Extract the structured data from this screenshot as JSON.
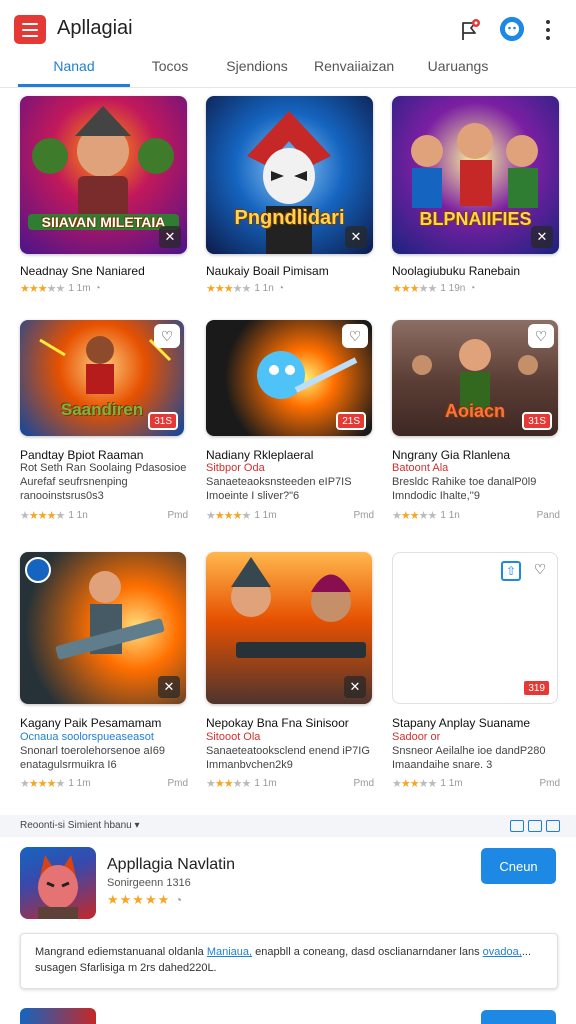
{
  "app": {
    "title": "Apllagiai"
  },
  "header": {
    "menu_icon": "hamburger-menu-icon",
    "flag_icon": "flag-notification-icon",
    "avatar_icon": "avatar-icon",
    "more_icon": "more-vert-icon",
    "accent_color": "#1e7fd6",
    "brand_color": "#e53935"
  },
  "tabs": [
    {
      "label": "Nanad",
      "active": true
    },
    {
      "label": "Tocos"
    },
    {
      "label": "Sjendions"
    },
    {
      "label": "Renvaiiaizan"
    },
    {
      "label": "Uaruangs"
    }
  ],
  "cards": [
    {
      "art_title": "SIIAVAN MILETAIA",
      "name": "Neadnay Sne Naniared",
      "lines": [],
      "rating": 3.5,
      "meta": "1 1m",
      "right": "",
      "corner": "x"
    },
    {
      "art_title": "Pngndlidari",
      "name": "Naukaiy Boail Pimisam",
      "lines": [],
      "rating": 3.5,
      "meta": "1 1n",
      "right": "",
      "corner": "x"
    },
    {
      "art_title": "BLPNAIIFIES",
      "name": "Noolagiubuku Ranebain",
      "lines": [],
      "rating": 3.5,
      "meta": "1 19n",
      "right": "",
      "corner": "x"
    },
    {
      "art_title": "Saandiren",
      "name": "Pandtay Bpiot Raaman",
      "lines": [
        {
          "text": "Rot Seth Ran Soolaing Pdasosioe",
          "style": ""
        },
        {
          "text": "Aurefaf seufrsnenping",
          "style": ""
        },
        {
          "text": "ranooinstsrus0s3",
          "style": ""
        }
      ],
      "rating": 3.5,
      "meta": "1 1n",
      "right": "Pmd",
      "badge": "31S"
    },
    {
      "art_title": "",
      "name": "Nadiany Rkleplaeral",
      "lines": [
        {
          "text": "Sitbpor Oda",
          "style": "red"
        },
        {
          "text": "Sanaeteaoksnsteeden eIP7IS",
          "style": ""
        },
        {
          "text": "Imoeinte I sliver?\"6",
          "style": ""
        }
      ],
      "rating": 3.5,
      "meta": "1 1m",
      "right": "Pmd",
      "badge": "21S"
    },
    {
      "art_title": "Aoiacn",
      "name": "Nngrany Gia Rlanlena",
      "lines": [
        {
          "text": "Batoont Ala",
          "style": "red"
        },
        {
          "text": "Bresldc Rahike toe danalP0l9",
          "style": ""
        },
        {
          "text": "Imndodic Ihalte,''9",
          "style": ""
        }
      ],
      "rating": 3,
      "meta": "1 1n",
      "right": "Pand",
      "badge": "31S"
    },
    {
      "art_title": "",
      "name": "Kagany Paik Pesamamam",
      "lines": [
        {
          "text": "Ocnaua soolorspueaseasot",
          "style": "blue"
        },
        {
          "text": "Snonarl toerolehorsenoe aI69",
          "style": ""
        },
        {
          "text": "enatagulsrmuikra I6",
          "style": ""
        }
      ],
      "rating": 3.5,
      "meta": "1 1m",
      "right": "Pmd",
      "corner": "x"
    },
    {
      "art_title": "",
      "name": "Nepokay Bna Fna Sinisoor",
      "lines": [
        {
          "text": "Sitooot Ola",
          "style": "red"
        },
        {
          "text": "Sanaeteatooksclend enend iP7IG",
          "style": ""
        },
        {
          "text": "Immanbvchen2k9",
          "style": ""
        }
      ],
      "rating": 3,
      "meta": "1 1m",
      "right": "Pmd",
      "corner": "x"
    },
    {
      "art_title": "",
      "name": "Stapany Anplay Suaname",
      "lines": [
        {
          "text": "Sadoor or",
          "style": "red"
        },
        {
          "text": "Snsneor Aeilalhe ioe dandP280",
          "style": ""
        },
        {
          "text": "Imaandaihe snare. 3",
          "style": ""
        }
      ],
      "rating": 3,
      "meta": "1 1m",
      "right": "Pmd",
      "badge": "319"
    }
  ],
  "section": {
    "label": "Reoonti-si Simient hbanu ▾"
  },
  "feature": {
    "name": "Appllagia Navlatin",
    "sub": "Sonirgeenn 1316",
    "stars": "★★★★★",
    "button": "Cneun"
  },
  "description": {
    "text_a": "Mangrand ediemstanuanal oldanla ",
    "link_a": "Maniaua,",
    "text_b": " enapbll a coneang, dasd osclianarndaner lans ",
    "link_b": "ovadoa,",
    "text_c": "...",
    "line2": "susagen Sfarlisiga m 2rs dahed220L."
  }
}
